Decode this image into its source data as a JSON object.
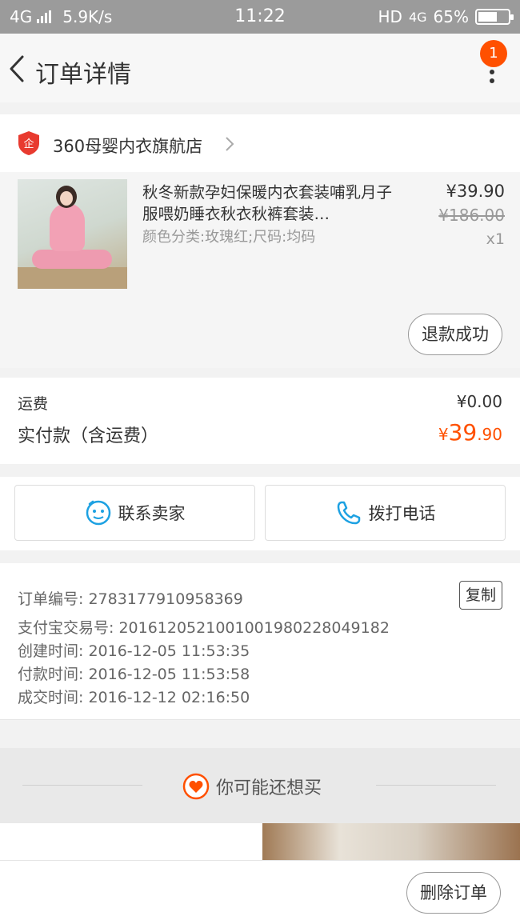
{
  "status_bar": {
    "network": "4G",
    "speed": "5.9K/s",
    "time": "11:22",
    "hd": "HD",
    "network_right": "4G",
    "battery": "65%",
    "battery_level": 0.65
  },
  "nav": {
    "back_icon": "chevron-left-icon",
    "title": "订单详情",
    "more_icon": "more-vertical-icon",
    "badge": "1",
    "badge_color": "#ff5000"
  },
  "store": {
    "icon": "shield-enterprise-icon",
    "name": "360母婴内衣旗航店"
  },
  "product": {
    "title": "秋冬新款孕妇保暖内衣套装哺乳月子服喂奶睡衣秋衣秋裤套装…",
    "sku": "颜色分类:玫瑰红;尺码:均码",
    "price": "¥39.90",
    "original_price": "¥186.00",
    "quantity": "x1",
    "status_button": "退款成功"
  },
  "fees": {
    "shipping_label": "运费",
    "shipping_value": "¥0.00",
    "total_label": "实付款（含运费）",
    "total_currency": "¥",
    "total_integer": "39",
    "total_decimal": ".90",
    "accent_color": "#ff5000"
  },
  "actions": {
    "contact_seller": "联系卖家",
    "call_phone": "拨打电话"
  },
  "order_info": {
    "order_no": "订单编号: 2783177910958369",
    "alipay_no": "支付宝交易号: 2016120521001001980228049182",
    "created": "创建时间: 2016-12-05 11:53:35",
    "paid": "付款时间: 2016-12-05 11:53:58",
    "completed": "成交时间: 2016-12-12 02:16:50",
    "copy_button": "复制"
  },
  "suggest": {
    "label": "你可能还想买"
  },
  "bottom": {
    "delete_order": "删除订单"
  }
}
